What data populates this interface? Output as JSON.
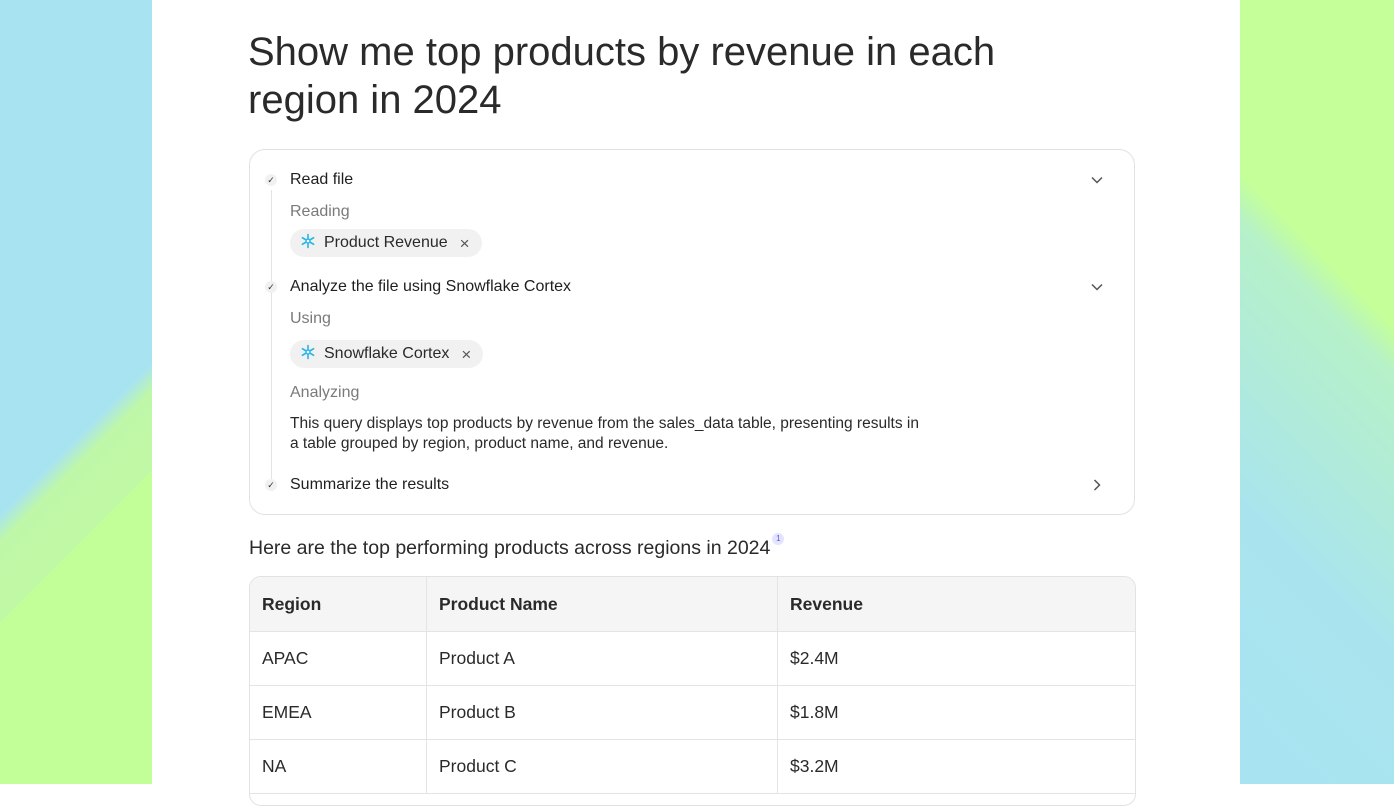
{
  "query": {
    "title": "Show me top products by revenue in each region in 2024"
  },
  "steps": [
    {
      "title": "Read file",
      "sub_label": "Reading",
      "chip": "Product Revenue",
      "expanded": true
    },
    {
      "title": "Analyze the file using Snowflake Cortex",
      "sub_label": "Using",
      "chip": "Snowflake Cortex",
      "analyzing_label": "Analyzing",
      "description": "This query displays top products by revenue from the sales_data table, presenting results in a table grouped by region, product name, and revenue.",
      "expanded": true
    },
    {
      "title": "Summarize the results",
      "expanded": false
    }
  ],
  "answer": {
    "summary": "Here are the top performing products across regions in 2024",
    "citation": "1"
  },
  "table": {
    "headers": [
      "Region",
      "Product Name",
      "Revenue"
    ],
    "rows": [
      [
        "APAC",
        "Product A",
        "$2.4M"
      ],
      [
        "EMEA",
        "Product B",
        "$1.8M"
      ],
      [
        "NA",
        "Product C",
        "$3.2M"
      ]
    ]
  },
  "colors": {
    "accent_snowflake": "#29b5e8",
    "citation_bg": "#e5e4ff",
    "background_green": "#c4ff9a",
    "background_blue": "#a8e3f2"
  }
}
